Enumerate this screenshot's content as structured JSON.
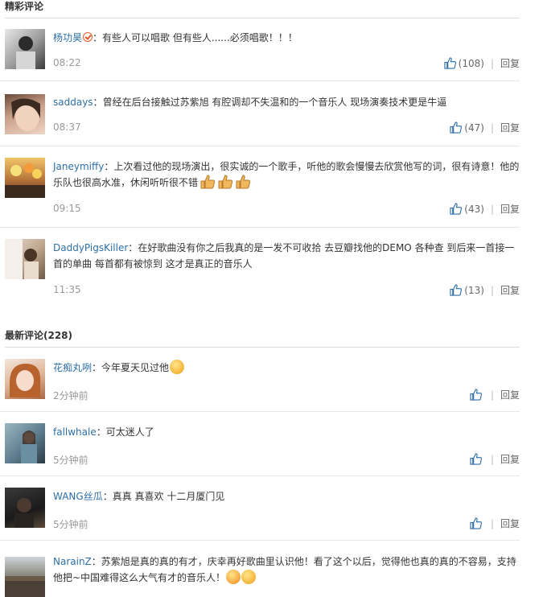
{
  "hot": {
    "title": "精彩评论",
    "comments": [
      {
        "user": "杨功昊",
        "sep": "：",
        "text": "有些人可以唱歌 但有些人......必须唱歌！！！",
        "time": "08:22",
        "likes": "(108)",
        "reply": "回复",
        "avatar": "avatar-bw-man"
      },
      {
        "user": "saddays",
        "sep": "：",
        "text": "曾经在后台接触过苏紫旭 有腔调却不失温和的一个音乐人 现场演奏技术更是牛逼",
        "time": "08:37",
        "likes": "(47)",
        "reply": "回复",
        "avatar": "avatar-woman-face"
      },
      {
        "user": "Janeymiffy",
        "sep": "：",
        "text": "上次看过他的现场演出，很实诚的一个歌手，听他的歌会慢慢去欣赏他写的词，很有诗意！他的乐队也很高水准，休闲听听很不错",
        "time": "09:15",
        "likes": "(43)",
        "reply": "回复",
        "avatar": "avatar-flowers"
      },
      {
        "user": "DaddyPigsKiller",
        "sep": "：",
        "text": "在好歌曲没有你之后我真的是一发不可收拾 去豆瓣找他的DEMO 各种查 到后来一首接一首的单曲 每首都有被惊到 这才是真正的音乐人",
        "time": "11:35",
        "likes": "(13)",
        "reply": "回复",
        "avatar": "avatar-girl-window"
      }
    ]
  },
  "latest": {
    "title": "最新评论(228)",
    "comments": [
      {
        "user": "花痴丸咧",
        "sep": "：",
        "text": "今年夏天见过他",
        "time": "2分钟前",
        "likes": "",
        "reply": "回复",
        "avatar": "avatar-doll"
      },
      {
        "user": "fallwhale",
        "sep": "：",
        "text": "可太迷人了",
        "time": "5分钟前",
        "likes": "",
        "reply": "回复",
        "avatar": "avatar-girl-blue"
      },
      {
        "user": "WANG丝瓜",
        "sep": "：",
        "text": "真真 真喜欢 十二月厦门见",
        "time": "5分钟前",
        "likes": "",
        "reply": "回复",
        "avatar": "avatar-dark"
      },
      {
        "user": "NarainZ",
        "sep": "：",
        "text": "苏紫旭是真的真的有才，庆幸再好歌曲里认识他！看了这个以后，觉得他也真的真的不容易，支持他把~中国难得这么大气有才的音乐人！",
        "time": "",
        "likes": "",
        "reply": "",
        "avatar": "avatar-landscape"
      }
    ]
  },
  "colors": {
    "username": "#2d6fa6",
    "time": "#999999",
    "divider": "#e6e6e6"
  }
}
